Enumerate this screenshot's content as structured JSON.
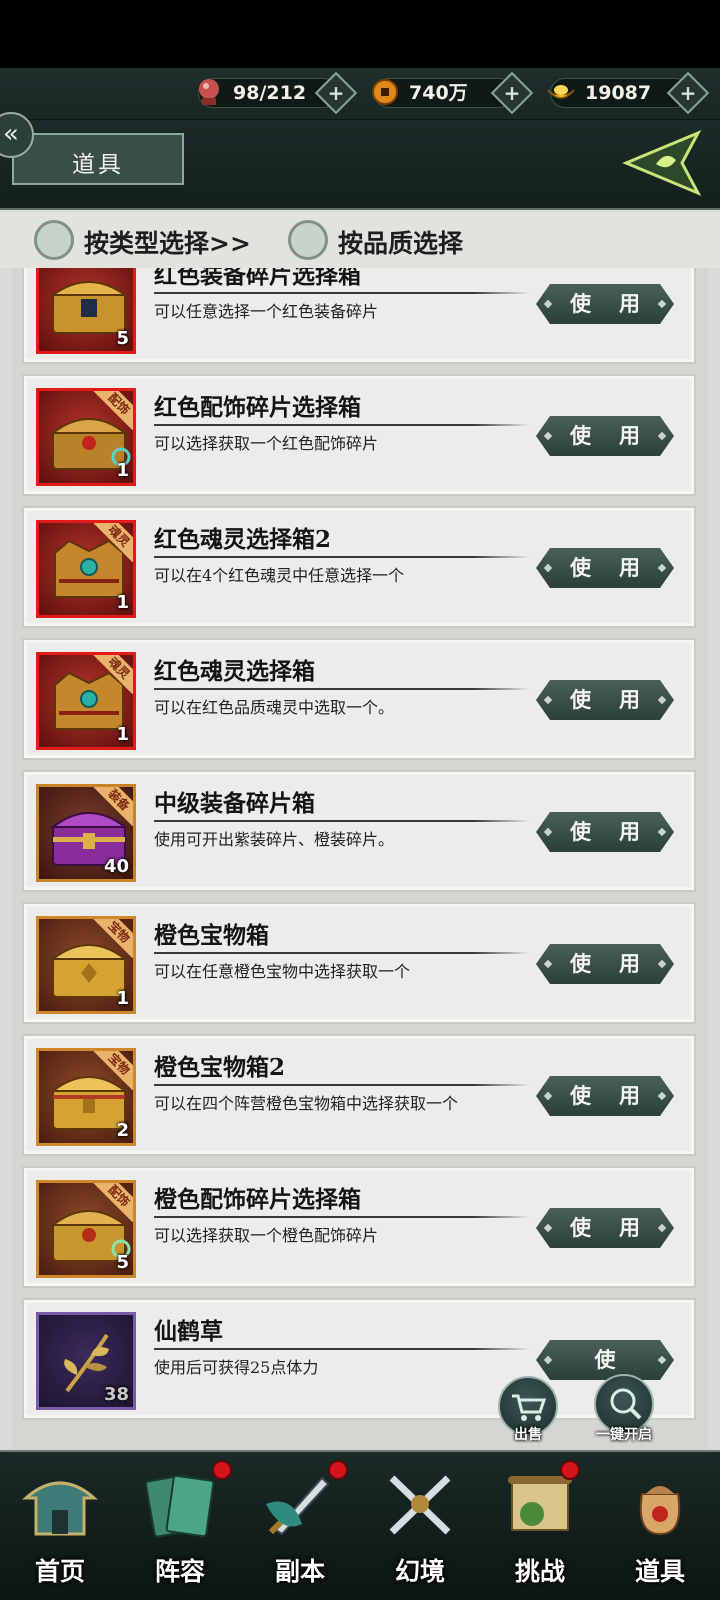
{
  "resources": [
    {
      "icon": "stamina-orb-icon",
      "value": "98/212",
      "plus": "+"
    },
    {
      "icon": "coin-icon",
      "value": "740万",
      "plus": "+"
    },
    {
      "icon": "gold-ingot-icon",
      "value": "19087",
      "plus": "+"
    }
  ],
  "header": {
    "back_glyph": "«",
    "title": "道具",
    "emblem_icon": "game-emblem-icon"
  },
  "filters": [
    {
      "label": "按类型选择>>"
    },
    {
      "label": "按品质选择"
    }
  ],
  "items": [
    {
      "name": "红色装备碎片选择箱",
      "desc": "可以任意选择一个红色装备碎片",
      "count": "5",
      "tag": "",
      "rarity": "red",
      "icon": "red-equipment-chest-icon",
      "button": "使用"
    },
    {
      "name": "红色配饰碎片选择箱",
      "desc": "可以选择获取一个红色配饰碎片",
      "count": "1",
      "tag": "配饰",
      "rarity": "red",
      "icon": "red-accessory-chest-icon",
      "button": "使用"
    },
    {
      "name": "红色魂灵选择箱2",
      "desc": "可以在4个红色魂灵中任意选择一个",
      "count": "1",
      "tag": "魂灵",
      "rarity": "red",
      "icon": "red-spirit-chest-icon",
      "button": "使用"
    },
    {
      "name": "红色魂灵选择箱",
      "desc": "可以在红色品质魂灵中选取一个。",
      "count": "1",
      "tag": "魂灵",
      "rarity": "red",
      "icon": "red-spirit-chest-icon",
      "button": "使用"
    },
    {
      "name": "中级装备碎片箱",
      "desc": "使用可开出紫装碎片、橙装碎片。",
      "count": "40",
      "tag": "装备",
      "rarity": "purple",
      "icon": "mid-equipment-chest-icon",
      "button": "使用"
    },
    {
      "name": "橙色宝物箱",
      "desc": "可以在任意橙色宝物中选择获取一个",
      "count": "1",
      "tag": "宝物",
      "rarity": "orange",
      "icon": "orange-treasure-chest-icon",
      "button": "使用"
    },
    {
      "name": "橙色宝物箱2",
      "desc": "可以在四个阵营橙色宝物箱中选择获取一个",
      "count": "2",
      "tag": "宝物",
      "rarity": "orange",
      "icon": "orange-treasure-chest-icon",
      "button": "使用"
    },
    {
      "name": "橙色配饰碎片选择箱",
      "desc": "可以选择获取一个橙色配饰碎片",
      "count": "5",
      "tag": "配饰",
      "rarity": "orange",
      "icon": "orange-accessory-chest-icon",
      "button": "使用"
    },
    {
      "name": "仙鹤草",
      "desc": "使用后可获得25点体力",
      "count": "38",
      "tag": "",
      "rarity": "violet",
      "icon": "herb-icon",
      "button": "使"
    }
  ],
  "floating": {
    "sell": {
      "label": "出售",
      "icon": "cart-icon"
    },
    "open_all": {
      "label": "一键开启",
      "icon": "magnifier-icon"
    }
  },
  "nav": [
    {
      "label": "首页",
      "icon": "home-pavilion-icon",
      "dot": false
    },
    {
      "label": "阵容",
      "icon": "lineup-cards-icon",
      "dot": true
    },
    {
      "label": "副本",
      "icon": "sword-dungeon-icon",
      "dot": true
    },
    {
      "label": "幻境",
      "icon": "crossed-swords-icon",
      "dot": false
    },
    {
      "label": "挑战",
      "icon": "scroll-challenge-icon",
      "dot": true
    },
    {
      "label": "道具",
      "icon": "item-bag-icon",
      "dot": false
    }
  ],
  "colors": {
    "accent": "#2c3f3a",
    "rarity_red": "#e21a1a",
    "badge_red": "#d4141a"
  }
}
